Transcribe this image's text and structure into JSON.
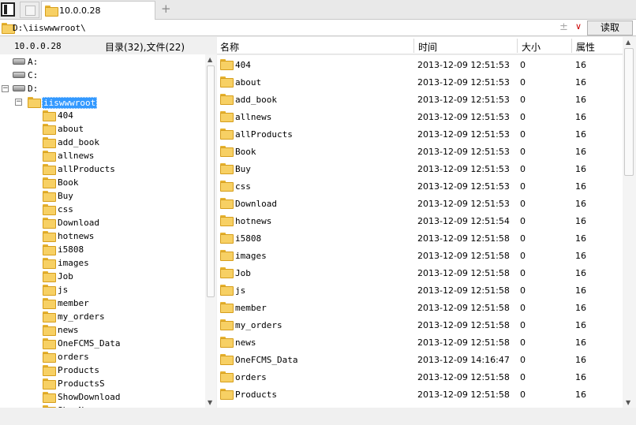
{
  "tabs": {
    "active_label": "10.0.0.28",
    "add_label": "+"
  },
  "address": {
    "path": "D:\\iiswwwroot\\",
    "read_button": "读取",
    "plus": "±",
    "chevron": "∨"
  },
  "left_header": {
    "host": "10.0.0.28",
    "counts": "目录(32),文件(22)"
  },
  "tree": {
    "drives": [
      "A:",
      "C:",
      "D:"
    ],
    "selected": "iiswwwroot",
    "children": [
      "404",
      "about",
      "add_book",
      "allnews",
      "allProducts",
      "Book",
      "Buy",
      "css",
      "Download",
      "hotnews",
      "i5808",
      "images",
      "Job",
      "js",
      "member",
      "my_orders",
      "news",
      "OneFCMS_Data",
      "orders",
      "Products",
      "ProductsS",
      "ShowDownload",
      "ShowNews"
    ]
  },
  "columns": {
    "name": "名称",
    "time": "时间",
    "size": "大小",
    "attr": "属性"
  },
  "files": [
    {
      "name": "404",
      "time": "2013-12-09 12:51:53",
      "size": "0",
      "attr": "16"
    },
    {
      "name": "about",
      "time": "2013-12-09 12:51:53",
      "size": "0",
      "attr": "16"
    },
    {
      "name": "add_book",
      "time": "2013-12-09 12:51:53",
      "size": "0",
      "attr": "16"
    },
    {
      "name": "allnews",
      "time": "2013-12-09 12:51:53",
      "size": "0",
      "attr": "16"
    },
    {
      "name": "allProducts",
      "time": "2013-12-09 12:51:53",
      "size": "0",
      "attr": "16"
    },
    {
      "name": "Book",
      "time": "2013-12-09 12:51:53",
      "size": "0",
      "attr": "16"
    },
    {
      "name": "Buy",
      "time": "2013-12-09 12:51:53",
      "size": "0",
      "attr": "16"
    },
    {
      "name": "css",
      "time": "2013-12-09 12:51:53",
      "size": "0",
      "attr": "16"
    },
    {
      "name": "Download",
      "time": "2013-12-09 12:51:53",
      "size": "0",
      "attr": "16"
    },
    {
      "name": "hotnews",
      "time": "2013-12-09 12:51:54",
      "size": "0",
      "attr": "16"
    },
    {
      "name": "i5808",
      "time": "2013-12-09 12:51:58",
      "size": "0",
      "attr": "16"
    },
    {
      "name": "images",
      "time": "2013-12-09 12:51:58",
      "size": "0",
      "attr": "16"
    },
    {
      "name": "Job",
      "time": "2013-12-09 12:51:58",
      "size": "0",
      "attr": "16"
    },
    {
      "name": "js",
      "time": "2013-12-09 12:51:58",
      "size": "0",
      "attr": "16"
    },
    {
      "name": "member",
      "time": "2013-12-09 12:51:58",
      "size": "0",
      "attr": "16"
    },
    {
      "name": "my_orders",
      "time": "2013-12-09 12:51:58",
      "size": "0",
      "attr": "16"
    },
    {
      "name": "news",
      "time": "2013-12-09 12:51:58",
      "size": "0",
      "attr": "16"
    },
    {
      "name": "OneFCMS_Data",
      "time": "2013-12-09 14:16:47",
      "size": "0",
      "attr": "16"
    },
    {
      "name": "orders",
      "time": "2013-12-09 12:51:58",
      "size": "0",
      "attr": "16"
    },
    {
      "name": "Products",
      "time": "2013-12-09 12:51:58",
      "size": "0",
      "attr": "16"
    }
  ],
  "icons": {
    "folder": "folder-icon",
    "drive": "drive-icon"
  },
  "colors": {
    "selection": "#3399ff",
    "folder": "#f7d064",
    "read_chevron": "#cc0000"
  }
}
